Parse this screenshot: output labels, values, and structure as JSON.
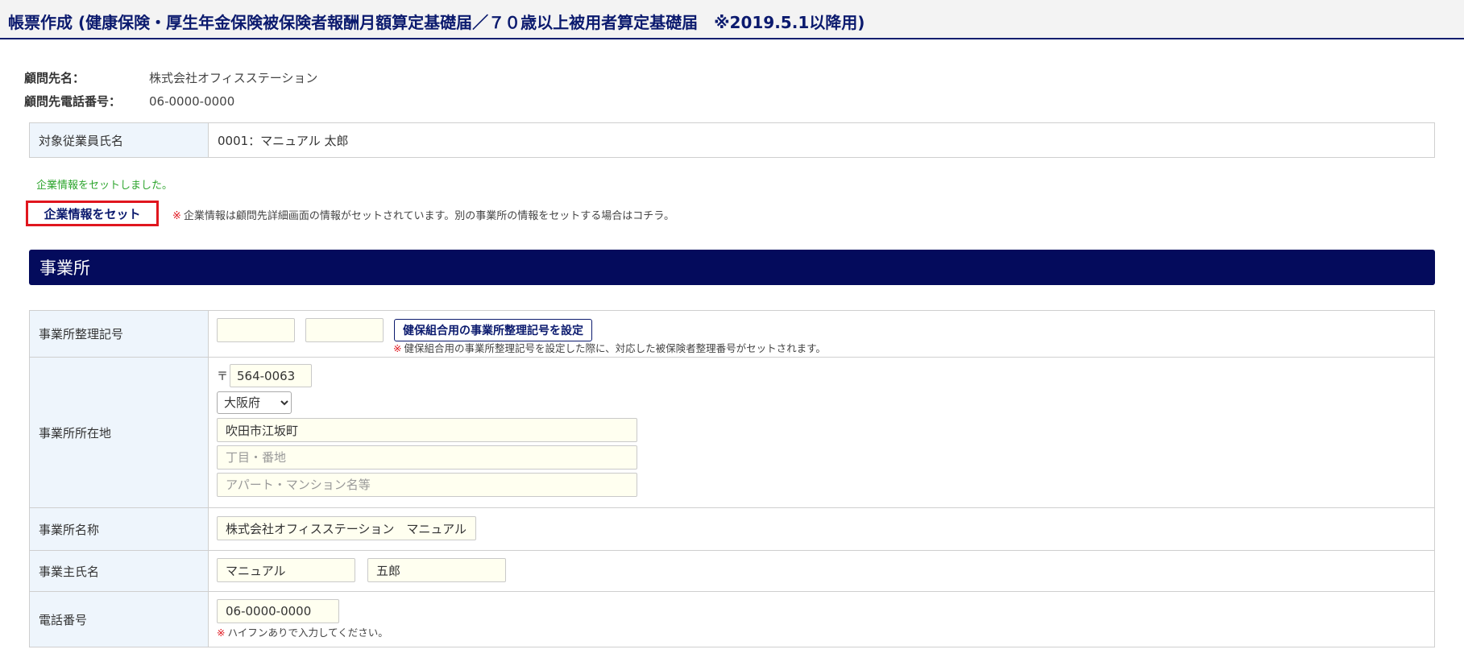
{
  "header": {
    "title": "帳票作成 (健康保険・厚生年金保険被保険者報酬月額算定基礎届／７０歳以上被用者算定基礎届　※2019.5.1以降用)"
  },
  "client": {
    "name_label": "顧問先名：",
    "name_value": "株式会社オフィスステーション",
    "phone_label": "顧問先電話番号：",
    "phone_value": "06-0000-0000"
  },
  "employee": {
    "label": "対象従業員氏名",
    "value": "0001：マニュアル 太郎"
  },
  "company_info": {
    "set_message": "企業情報をセットしました。",
    "set_button": "企業情報をセット",
    "note_mark": "※",
    "note": "企業情報は顧問先詳細画面の情報がセットされています。別の事業所の情報をセットする場合はコチラ。"
  },
  "section": {
    "title": "事業所"
  },
  "form": {
    "office_code": {
      "label": "事業所整理記号",
      "value1": "",
      "value2": "",
      "button": "健保組合用の事業所整理記号を設定",
      "note_mark": "※",
      "note": "健保組合用の事業所整理記号を設定した際に、対応した被保険者整理番号がセットされます。"
    },
    "address": {
      "label": "事業所所在地",
      "postal_mark": "〒",
      "postal": "564-0063",
      "prefecture": "大阪府",
      "city": "吹田市江坂町",
      "street_placeholder": "丁目・番地",
      "building_placeholder": "アパート・マンション名等"
    },
    "office_name": {
      "label": "事業所名称",
      "value": "株式会社オフィスステーション　マニュアル"
    },
    "owner_name": {
      "label": "事業主氏名",
      "last": "マニュアル",
      "first": "五郎"
    },
    "phone": {
      "label": "電話番号",
      "value": "06-0000-0000",
      "note_mark": "※",
      "note": "ハイフンありで入力してください。"
    }
  },
  "colors": {
    "header_title": "#0b1a6e",
    "section_bar": "#040b5c",
    "label_bg": "#eef5fc",
    "input_bg": "#fffff0",
    "success": "#2ea52e",
    "alert": "#e0161e"
  }
}
